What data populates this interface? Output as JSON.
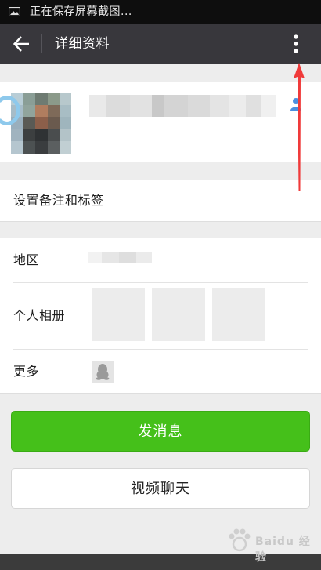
{
  "statusbar": {
    "text": "正在保存屏幕截图..."
  },
  "toolbar": {
    "title": "详细资料"
  },
  "settings": {
    "remark_label": "设置备注和标签"
  },
  "info": {
    "region_label": "地区",
    "album_label": "个人相册",
    "more_label": "更多"
  },
  "actions": {
    "send_message": "发消息",
    "video_chat": "视频聊天"
  },
  "watermark": {
    "text": "Baidu 经验"
  },
  "colors": {
    "toolbar_bg": "#38373c",
    "accent_green": "#45c01a",
    "annotation_arrow": "#f03a3a",
    "background": "#ededed"
  },
  "icons": [
    "image-icon",
    "back-arrow-icon",
    "more-vertical-icon",
    "person-icon",
    "qq-penguin-icon",
    "paw-logo"
  ]
}
